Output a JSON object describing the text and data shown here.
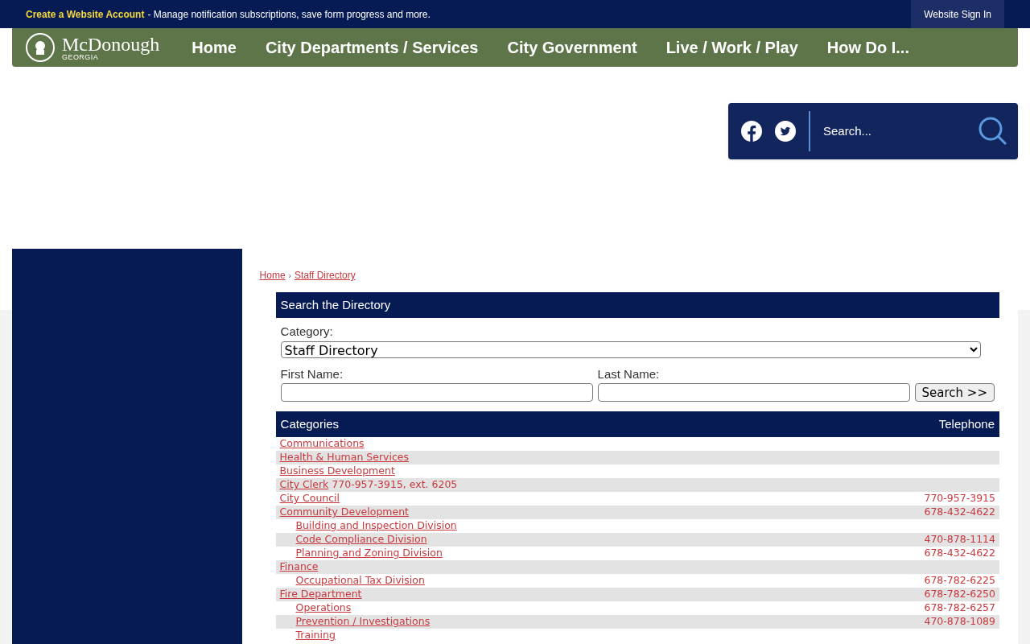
{
  "top_bar": {
    "account_link": "Create a Website Account",
    "account_text": "- Manage notification subscriptions, save form progress and more.",
    "sign_in": "Website Sign In"
  },
  "header": {
    "logo_name": "McDonough",
    "logo_state": "GEORGIA",
    "nav": [
      "Home",
      "City Departments / Services",
      "City Government",
      "Live / Work / Play",
      "How Do I..."
    ]
  },
  "search": {
    "placeholder": "Search..."
  },
  "breadcrumb": [
    "Home",
    "Staff Directory"
  ],
  "breadcrumb_separator": "›",
  "directory_search": {
    "title": "Search the Directory",
    "category_label": "Category:",
    "category_value": "Staff Directory",
    "first_name_label": "First Name:",
    "last_name_label": "Last Name:",
    "button": "Search >>"
  },
  "table": {
    "columns": [
      "Categories",
      "Telephone"
    ],
    "rows": [
      {
        "name": "Communications"
      },
      {
        "name": "Health & Human Services"
      },
      {
        "name": "Business Development"
      },
      {
        "name": "City Clerk",
        "note": "770-957-3915, ext. 6205"
      },
      {
        "name": "City Council",
        "phone": "770-957-3915"
      },
      {
        "name": "Community Development",
        "phone": "678-432-4622",
        "children": [
          {
            "name": "Building and Inspection Division"
          },
          {
            "name": "Code Compliance Division",
            "phone": "470-878-1114"
          },
          {
            "name": "Planning and Zoning Division",
            "phone": "678-432-4622"
          }
        ]
      },
      {
        "name": "Finance",
        "children": [
          {
            "name": "Occupational Tax Division",
            "phone": "678-782-6225"
          }
        ]
      },
      {
        "name": "Fire Department",
        "phone": "678-782-6250",
        "children": [
          {
            "name": "Operations",
            "phone": "678-782-6257"
          },
          {
            "name": "Prevention / Investigations",
            "phone": "470-878-1089"
          },
          {
            "name": "Training"
          }
        ]
      }
    ]
  }
}
